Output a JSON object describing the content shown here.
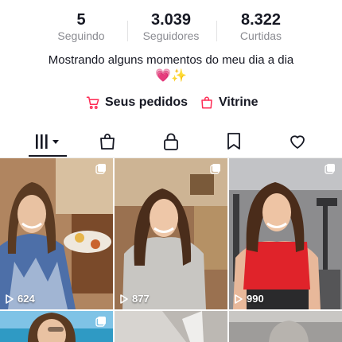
{
  "profile": {
    "stats": [
      {
        "value": "5",
        "label": "Seguindo"
      },
      {
        "value": "3.039",
        "label": "Seguidores"
      },
      {
        "value": "8.322",
        "label": "Curtidas"
      }
    ],
    "bio": "Mostrando alguns momentos do meu dia a dia",
    "bio_emojis": "💗✨"
  },
  "links": {
    "orders": "Seus pedidos",
    "showcase": "Vitrine",
    "accent_color": "#fe2c55"
  },
  "tabs": [
    {
      "name": "videos",
      "icon": "grid-bars-icon",
      "active": true
    },
    {
      "name": "shop",
      "icon": "shopping-bag-icon"
    },
    {
      "name": "private",
      "icon": "lock-icon"
    },
    {
      "name": "saved",
      "icon": "bookmark-icon"
    },
    {
      "name": "liked",
      "icon": "heart-icon"
    }
  ],
  "videos": [
    {
      "views": "624"
    },
    {
      "views": "877"
    },
    {
      "views": "990"
    }
  ]
}
